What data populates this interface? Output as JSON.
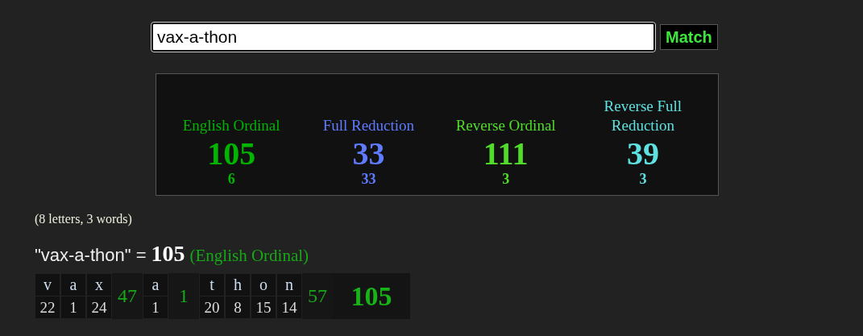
{
  "search": {
    "value": "vax-a-thon"
  },
  "match_button": "Match",
  "ciphers": [
    {
      "name": "English Ordinal",
      "value": "105",
      "reduced": "6",
      "color": "#00b400"
    },
    {
      "name": "Full Reduction",
      "value": "33",
      "reduced": "33",
      "color": "#5f7bff"
    },
    {
      "name": "Reverse Ordinal",
      "value": "111",
      "reduced": "3",
      "color": "#50dc28"
    },
    {
      "name": "Reverse Full Reduction",
      "value": "39",
      "reduced": "3",
      "color": "#5fe1e1"
    }
  ],
  "count": "(8 letters, 3 words)",
  "result": {
    "phrase": "\"vax-a-thon\" =",
    "value": "105",
    "cipher": "(English Ordinal)"
  },
  "breakdown": {
    "words": [
      {
        "letters": [
          {
            "letter": "v",
            "value": "22"
          },
          {
            "letter": "a",
            "value": "1"
          },
          {
            "letter": "x",
            "value": "24"
          }
        ],
        "sum": "47"
      },
      {
        "letters": [
          {
            "letter": "a",
            "value": "1"
          }
        ],
        "sum": "1"
      },
      {
        "letters": [
          {
            "letter": "t",
            "value": "20"
          },
          {
            "letter": "h",
            "value": "8"
          },
          {
            "letter": "o",
            "value": "15"
          },
          {
            "letter": "n",
            "value": "14"
          }
        ],
        "sum": "57"
      }
    ],
    "total": "105"
  }
}
